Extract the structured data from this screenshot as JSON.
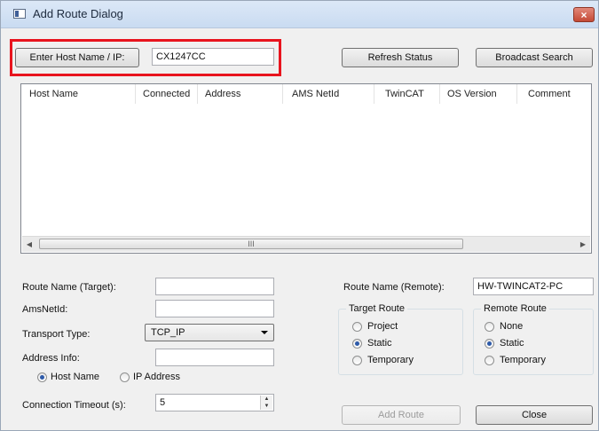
{
  "window": {
    "title": "Add Route Dialog",
    "close_glyph": "×"
  },
  "top": {
    "host_button": "Enter Host Name / IP:",
    "host_value": "CX1247CC",
    "refresh_button": "Refresh Status",
    "broadcast_button": "Broadcast Search"
  },
  "list": {
    "columns": [
      "Host Name",
      "Connected",
      "Address",
      "AMS NetId",
      "TwinCAT",
      "OS Version",
      "Comment"
    ],
    "scroll_left": "◀",
    "scroll_right": "▶",
    "thumb_grip": "III"
  },
  "form": {
    "route_name_target_label": "Route Name (Target):",
    "route_name_target_value": "",
    "amsnetid_label": "AmsNetId:",
    "amsnetid_value": "",
    "transport_label": "Transport Type:",
    "transport_value": "TCP_IP",
    "address_info_label": "Address Info:",
    "address_info_value": "",
    "host_name_radio": "Host Name",
    "ip_address_radio": "IP Address",
    "timeout_label": "Connection Timeout (s):",
    "timeout_value": "5",
    "spin_up": "▲",
    "spin_down": "▼"
  },
  "remote": {
    "route_name_remote_label": "Route Name (Remote):",
    "route_name_remote_value": "HW-TWINCAT2-PC",
    "target_route_title": "Target Route",
    "target_options": [
      "Project",
      "Static",
      "Temporary"
    ],
    "remote_route_title": "Remote Route",
    "remote_options": [
      "None",
      "Static",
      "Temporary"
    ]
  },
  "actions": {
    "add_route": "Add Route",
    "close": "Close"
  }
}
